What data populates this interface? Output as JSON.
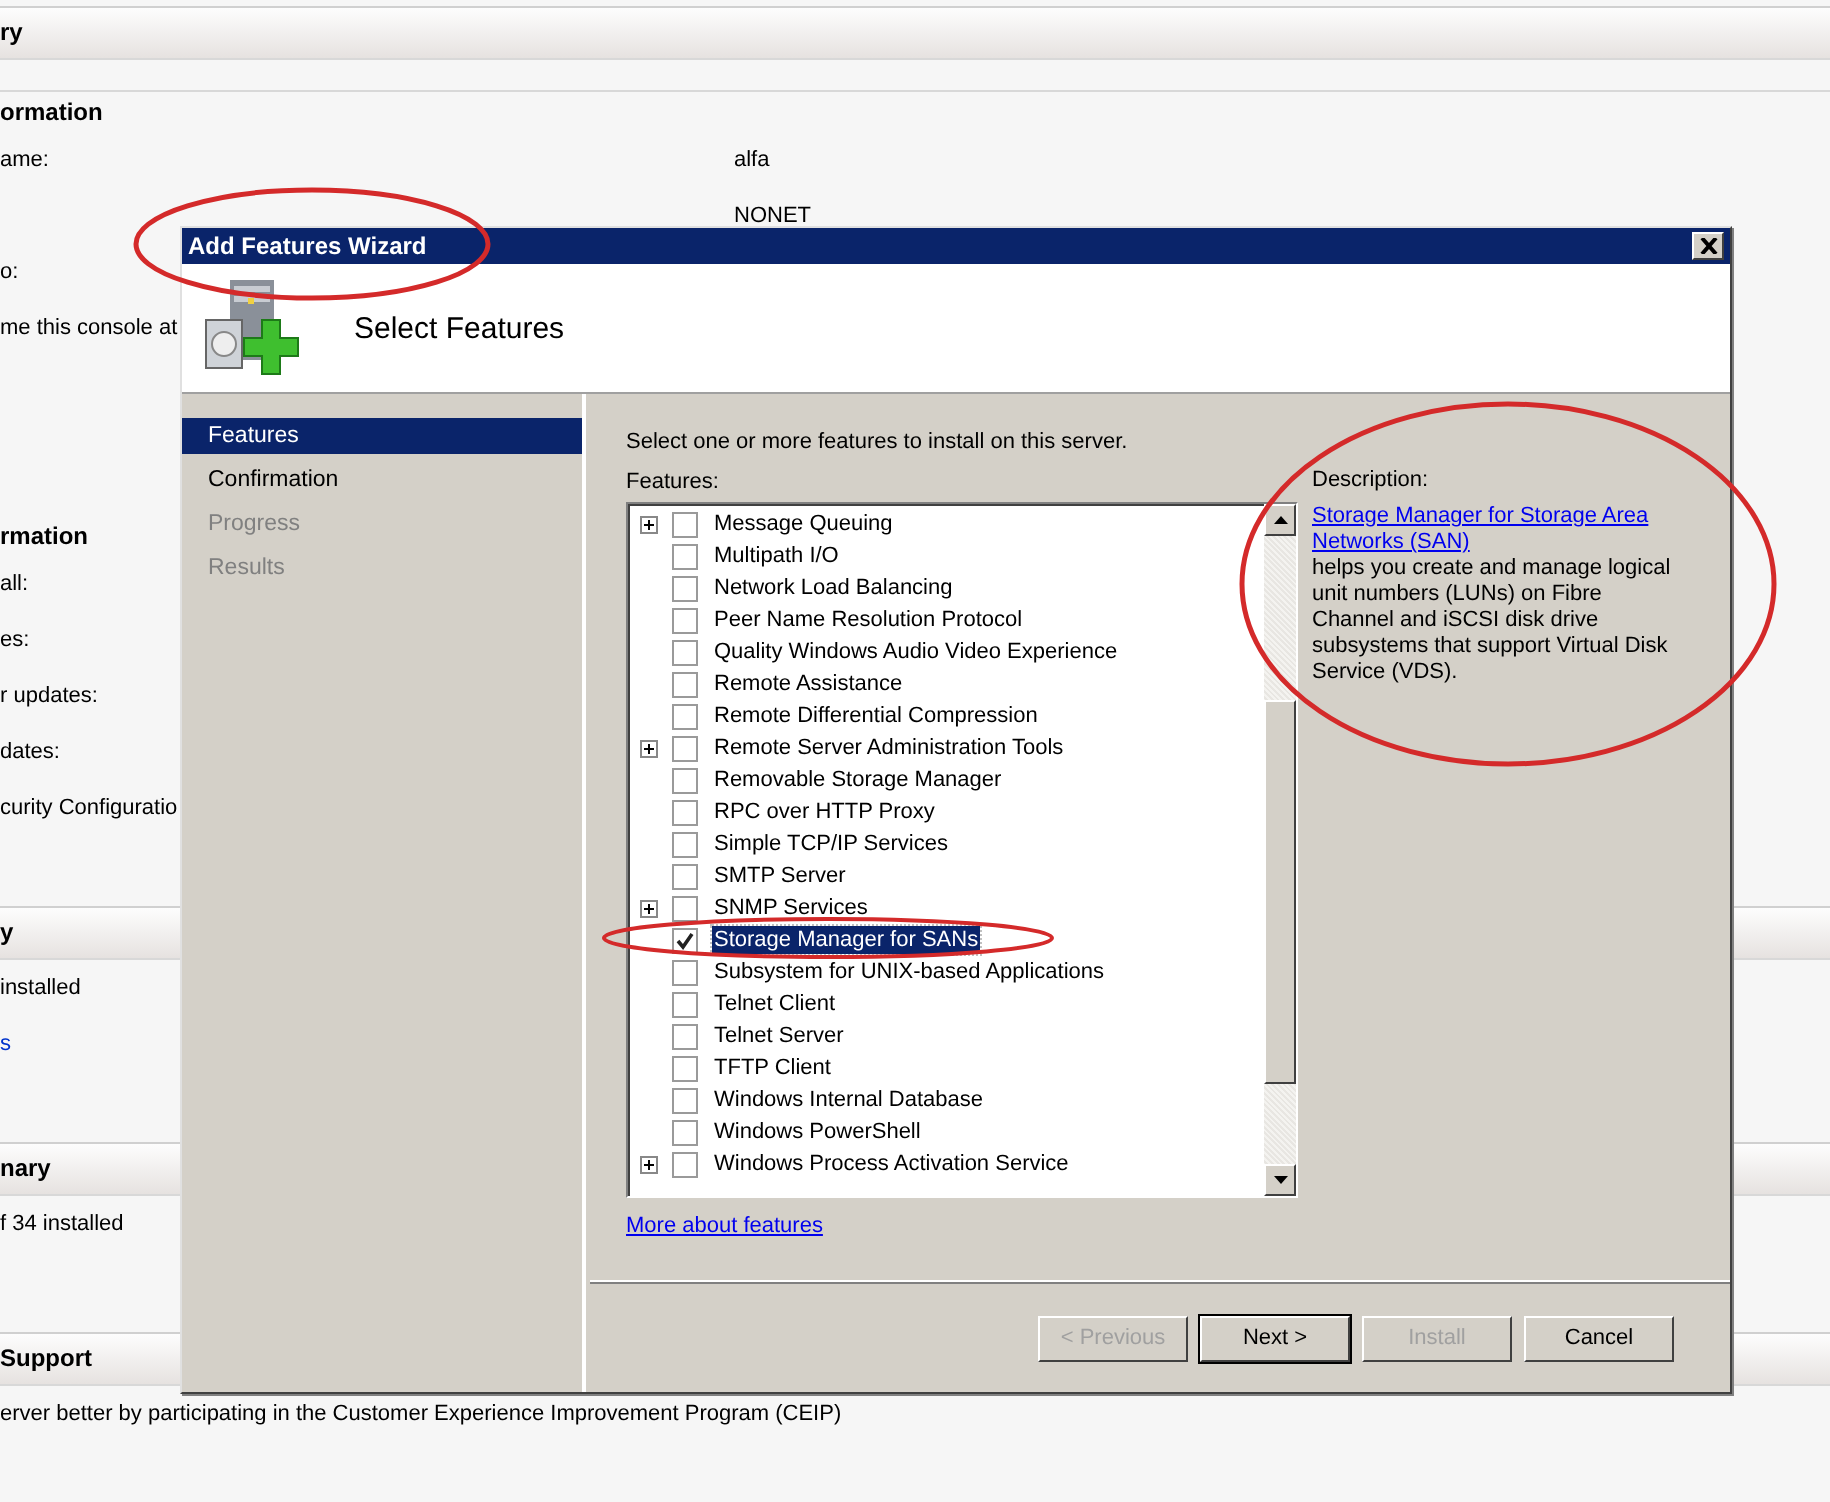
{
  "console": {
    "sections": [
      {
        "heading": "ry",
        "kind": "band"
      },
      {
        "heading": "ormation",
        "kind": "plain",
        "rows": [
          {
            "label": "ame:",
            "value": "alfa"
          },
          {
            "value": "NONET"
          },
          {
            "label": "o:"
          },
          {
            "label": "me this console at"
          }
        ]
      },
      {
        "heading": "rmation",
        "kind": "plain",
        "rows": [
          {
            "label": "all:"
          },
          {
            "label": "es:"
          },
          {
            "label": "r updates:"
          },
          {
            "label": "dates:"
          },
          {
            "label": "curity Configuratio"
          }
        ]
      },
      {
        "heading": "y",
        "kind": "band",
        "rows": [
          {
            "label": "installed"
          },
          {
            "link": "s"
          }
        ]
      },
      {
        "heading": "nary",
        "kind": "band",
        "rows": [
          {
            "label": "f 34 installed"
          }
        ]
      },
      {
        "heading": "Support",
        "kind": "band",
        "rows": [
          {
            "label": "erver better by participating in the Customer Experience Improvement Program (CEIP)"
          }
        ]
      }
    ]
  },
  "dialog": {
    "title": "Add Features Wizard",
    "page_title": "Select Features",
    "steps": [
      {
        "label": "Features",
        "selected": true,
        "disabled": false
      },
      {
        "label": "Confirmation",
        "selected": false,
        "disabled": false
      },
      {
        "label": "Progress",
        "selected": false,
        "disabled": true
      },
      {
        "label": "Results",
        "selected": false,
        "disabled": true
      }
    ],
    "instruction": "Select one or more features to install on this server.",
    "features_label": "Features:",
    "features": [
      {
        "label": "Message Queuing",
        "expandable": true,
        "checked": false,
        "selected": false
      },
      {
        "label": "Multipath I/O",
        "expandable": false,
        "checked": false,
        "selected": false
      },
      {
        "label": "Network Load Balancing",
        "expandable": false,
        "checked": false,
        "selected": false
      },
      {
        "label": "Peer Name Resolution Protocol",
        "expandable": false,
        "checked": false,
        "selected": false
      },
      {
        "label": "Quality Windows Audio Video Experience",
        "expandable": false,
        "checked": false,
        "selected": false
      },
      {
        "label": "Remote Assistance",
        "expandable": false,
        "checked": false,
        "selected": false
      },
      {
        "label": "Remote Differential Compression",
        "expandable": false,
        "checked": false,
        "selected": false
      },
      {
        "label": "Remote Server Administration Tools",
        "expandable": true,
        "checked": false,
        "selected": false
      },
      {
        "label": "Removable Storage Manager",
        "expandable": false,
        "checked": false,
        "selected": false
      },
      {
        "label": "RPC over HTTP Proxy",
        "expandable": false,
        "checked": false,
        "selected": false
      },
      {
        "label": "Simple TCP/IP Services",
        "expandable": false,
        "checked": false,
        "selected": false
      },
      {
        "label": "SMTP Server",
        "expandable": false,
        "checked": false,
        "selected": false
      },
      {
        "label": "SNMP Services",
        "expandable": true,
        "checked": false,
        "selected": false
      },
      {
        "label": "Storage Manager for SANs",
        "expandable": false,
        "checked": true,
        "selected": true
      },
      {
        "label": "Subsystem for UNIX-based Applications",
        "expandable": false,
        "checked": false,
        "selected": false
      },
      {
        "label": "Telnet Client",
        "expandable": false,
        "checked": false,
        "selected": false
      },
      {
        "label": "Telnet Server",
        "expandable": false,
        "checked": false,
        "selected": false
      },
      {
        "label": "TFTP Client",
        "expandable": false,
        "checked": false,
        "selected": false
      },
      {
        "label": "Windows Internal Database",
        "expandable": false,
        "checked": false,
        "selected": false
      },
      {
        "label": "Windows PowerShell",
        "expandable": false,
        "checked": false,
        "selected": false
      },
      {
        "label": "Windows Process Activation Service",
        "expandable": true,
        "checked": false,
        "selected": false
      }
    ],
    "more_link": "More about features",
    "description_label": "Description:",
    "description_link": "Storage Manager for Storage Area Networks (SAN)",
    "description_text": " helps you create and manage logical unit numbers (LUNs) on Fibre Channel and iSCSI disk drive subsystems that support Virtual Disk Service (VDS).",
    "buttons": [
      {
        "label": "< Previous",
        "disabled": true,
        "default": false
      },
      {
        "label": "Next >",
        "disabled": false,
        "default": true
      },
      {
        "label": "Install",
        "disabled": true,
        "default": false
      },
      {
        "label": "Cancel",
        "disabled": false,
        "default": false
      }
    ]
  }
}
